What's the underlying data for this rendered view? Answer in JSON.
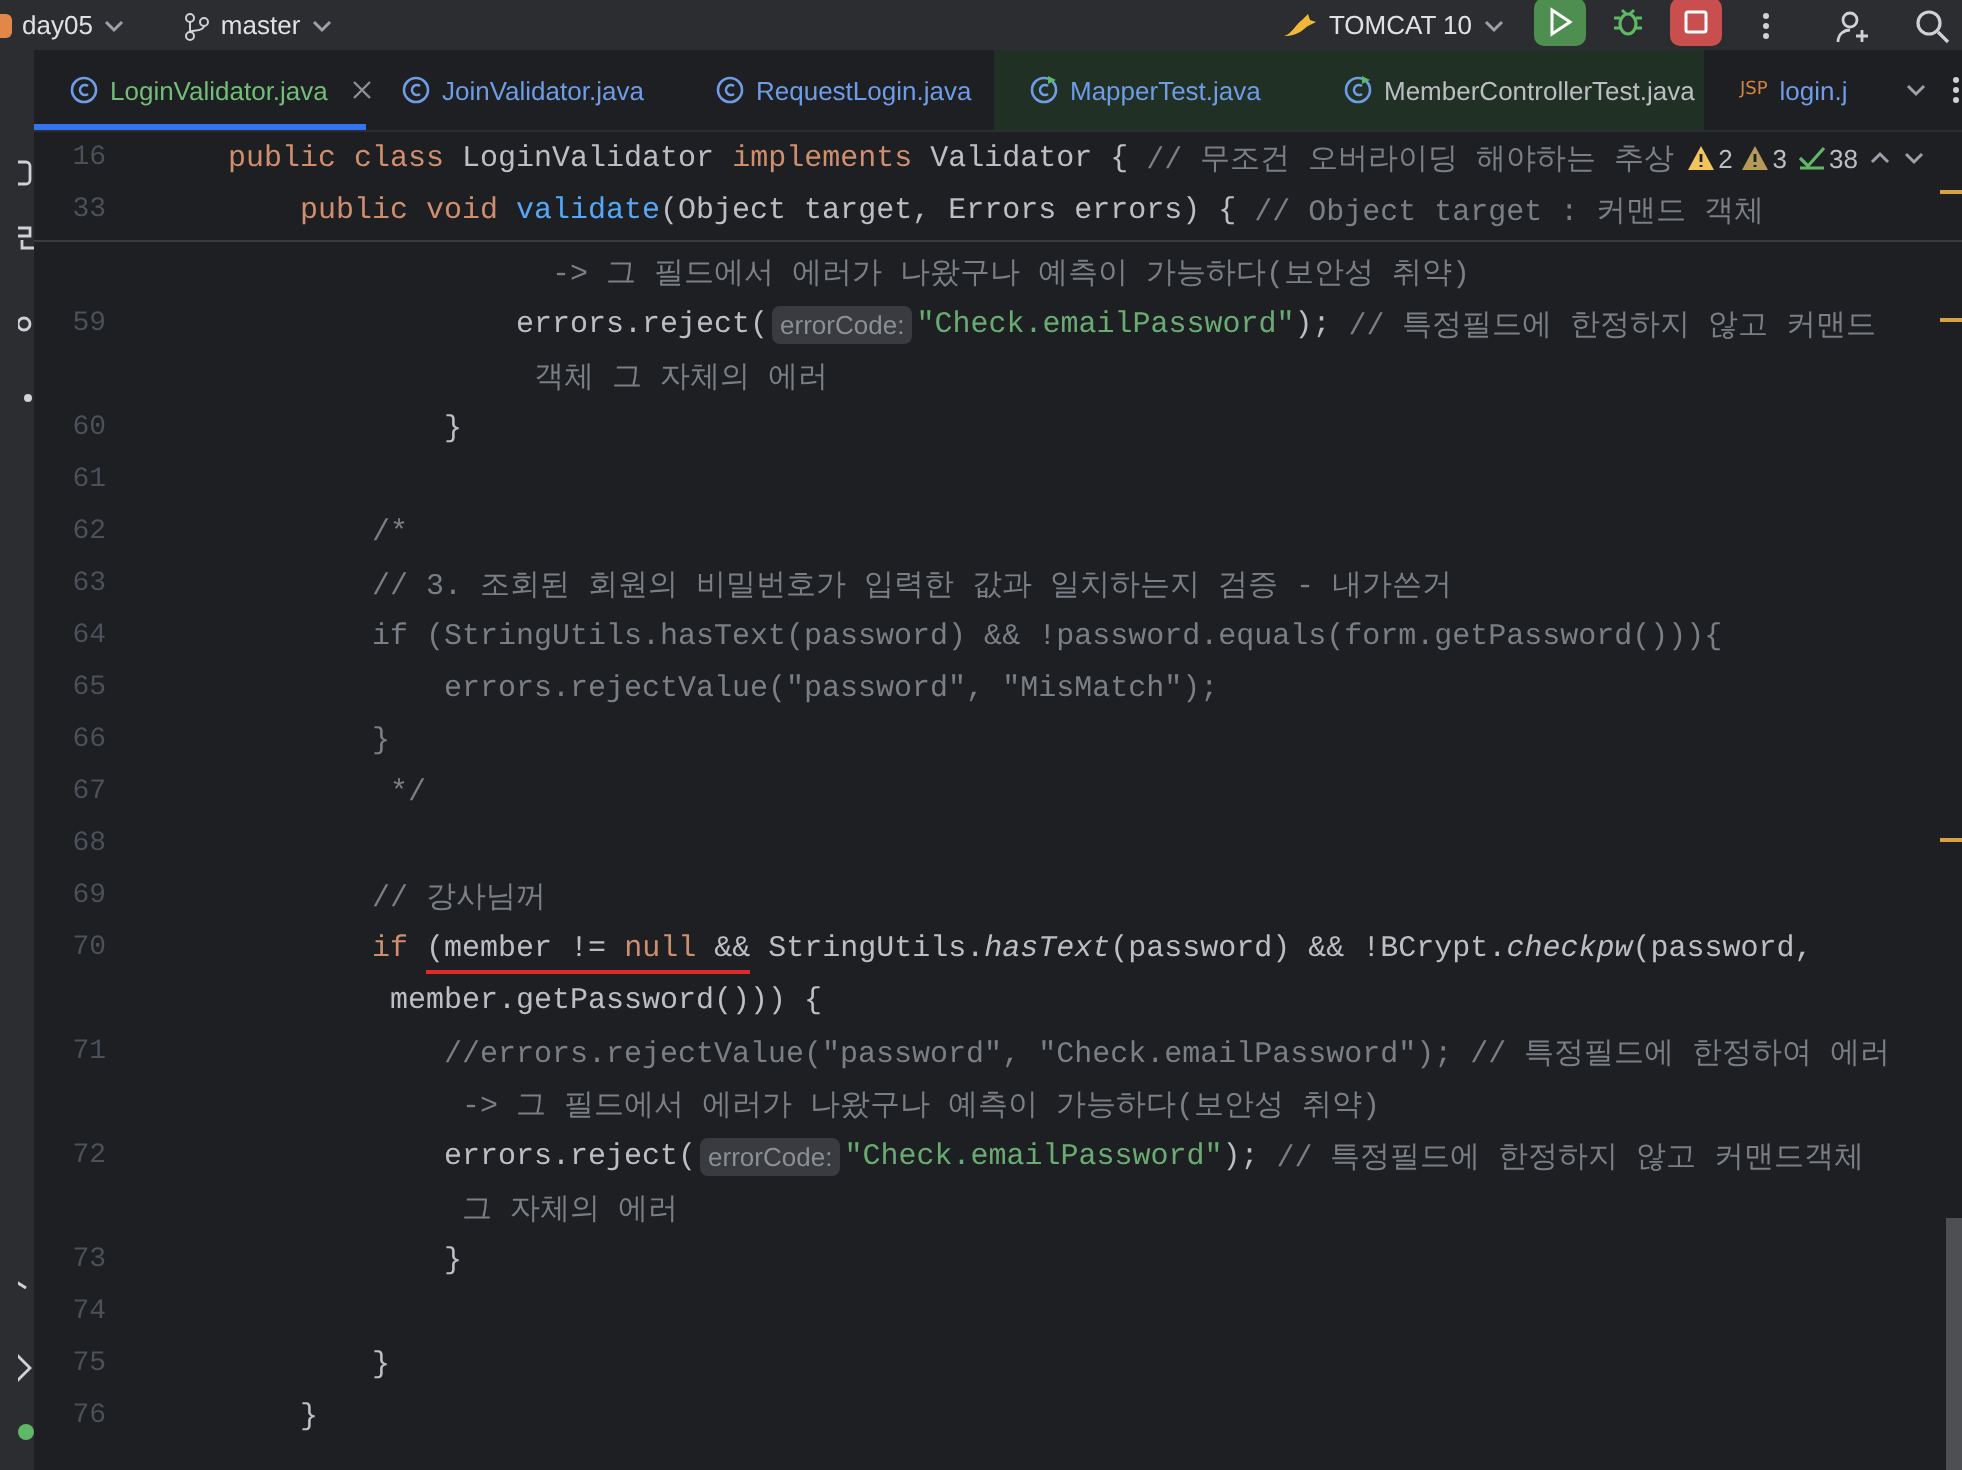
{
  "topbar": {
    "project": "day05",
    "branch": "master",
    "run_config": "TOMCAT 10"
  },
  "tabs": [
    {
      "label": "LoginValidator.java",
      "selected": true,
      "test": false,
      "color": "#73bd79",
      "closable": true
    },
    {
      "label": "JoinValidator.java",
      "selected": false,
      "test": false,
      "color": "#6f9ce6",
      "closable": false
    },
    {
      "label": "RequestLogin.java",
      "selected": false,
      "test": false,
      "color": "#6f9ce6",
      "closable": false
    },
    {
      "label": "MapperTest.java",
      "selected": false,
      "test": true,
      "color": "#6f9ce6",
      "closable": false
    },
    {
      "label": "MemberControllerTest.java",
      "selected": false,
      "test": true,
      "color": "#bcbec4",
      "closable": false
    },
    {
      "label": "login.j",
      "selected": false,
      "test": false,
      "color": "#6f9ce6",
      "closable": false,
      "badge": "JSP"
    }
  ],
  "inspections": [
    {
      "kind": "warning",
      "count": "2"
    },
    {
      "kind": "weak-warning",
      "count": "3"
    },
    {
      "kind": "ok",
      "count": "38"
    }
  ],
  "sticky_lines": [
    {
      "number": "16",
      "tokens": [
        {
          "kind": "keyword",
          "text": "public class "
        },
        {
          "kind": "plain",
          "text": "LoginValidator "
        },
        {
          "kind": "keyword",
          "text": "implements "
        },
        {
          "kind": "plain",
          "text": "Validator { "
        },
        {
          "kind": "comment",
          "text": "// 무조건 오버라이딩 해야하는 추상"
        }
      ]
    },
    {
      "number": "33",
      "tokens": [
        {
          "kind": "keyword",
          "text": "    public void "
        },
        {
          "kind": "method",
          "text": "validate"
        },
        {
          "kind": "plain",
          "text": "(Object target, Errors errors) { "
        },
        {
          "kind": "comment",
          "text": "// Object target : 커맨드 객체"
        }
      ]
    }
  ],
  "lines": [
    {
      "tokens": [
        {
          "kind": "comment",
          "text": "                  -> 그 필드에서 에러가 나왔구나 예측이 가능하다(보안성 취약)"
        }
      ]
    },
    {
      "number": "59",
      "tokens": [
        {
          "kind": "plain",
          "text": "                errors.reject("
        },
        {
          "kind": "hint",
          "text": "errorCode:"
        },
        {
          "kind": "string",
          "text": "\"Check.emailPassword\""
        },
        {
          "kind": "plain",
          "text": "); "
        },
        {
          "kind": "comment",
          "text": "// 특정필드에 한정하지 않고 커맨드"
        }
      ]
    },
    {
      "tokens": [
        {
          "kind": "comment",
          "text": "                 객체 그 자체의 에러"
        }
      ]
    },
    {
      "number": "60",
      "tokens": [
        {
          "kind": "plain",
          "text": "            }"
        }
      ]
    },
    {
      "number": "61"
    },
    {
      "number": "62",
      "tokens": [
        {
          "kind": "comment",
          "text": "        /*"
        }
      ]
    },
    {
      "number": "63",
      "tokens": [
        {
          "kind": "comment",
          "text": "        // 3. 조회된 회원의 비밀번호가 입력한 값과 일치하는지 검증 - 내가쓴거"
        }
      ]
    },
    {
      "number": "64",
      "tokens": [
        {
          "kind": "comment",
          "text": "        if (StringUtils.hasText(password) && !password.equals(form.getPassword())){"
        }
      ]
    },
    {
      "number": "65",
      "tokens": [
        {
          "kind": "comment",
          "text": "            errors.rejectValue(\"password\", \"MisMatch\");"
        }
      ]
    },
    {
      "number": "66",
      "tokens": [
        {
          "kind": "comment",
          "text": "        }"
        }
      ]
    },
    {
      "number": "67",
      "tokens": [
        {
          "kind": "comment",
          "text": "         */"
        }
      ]
    },
    {
      "number": "68"
    },
    {
      "number": "69",
      "tokens": [
        {
          "kind": "comment",
          "text": "        // 강사님꺼"
        }
      ]
    },
    {
      "number": "70",
      "tokens": [
        {
          "kind": "keyword",
          "text": "        if "
        },
        {
          "kind": "plain",
          "text": "(member != ",
          "underlined": true
        },
        {
          "kind": "keyword",
          "text": "null",
          "underlined": true
        },
        {
          "kind": "plain",
          "text": " &&",
          "underlined": true
        },
        {
          "kind": "plain",
          "text": " StringUtils."
        },
        {
          "kind": "static",
          "text": "hasText"
        },
        {
          "kind": "plain",
          "text": "(password) && !BCrypt."
        },
        {
          "kind": "static",
          "text": "checkpw"
        },
        {
          "kind": "plain",
          "text": "(password,"
        }
      ]
    },
    {
      "tokens": [
        {
          "kind": "plain",
          "text": "         member.getPassword())) {"
        }
      ]
    },
    {
      "number": "71",
      "tokens": [
        {
          "kind": "comment",
          "text": "            //errors.rejectValue(\"password\", \"Check.emailPassword\"); // 특정필드에 한정하여 에러"
        }
      ]
    },
    {
      "tokens": [
        {
          "kind": "comment",
          "text": "             -> 그 필드에서 에러가 나왔구나 예측이 가능하다(보안성 취약)"
        }
      ]
    },
    {
      "number": "72",
      "tokens": [
        {
          "kind": "plain",
          "text": "            errors.reject("
        },
        {
          "kind": "hint",
          "text": "errorCode:"
        },
        {
          "kind": "string",
          "text": "\"Check.emailPassword\""
        },
        {
          "kind": "plain",
          "text": "); "
        },
        {
          "kind": "comment",
          "text": "// 특정필드에 한정하지 않고 커맨드객체"
        }
      ]
    },
    {
      "tokens": [
        {
          "kind": "comment",
          "text": "             그 자체의 에러"
        }
      ]
    },
    {
      "number": "73",
      "tokens": [
        {
          "kind": "plain",
          "text": "            }"
        }
      ]
    },
    {
      "number": "74"
    },
    {
      "number": "75",
      "tokens": [
        {
          "kind": "plain",
          "text": "        }"
        }
      ]
    },
    {
      "number": "76",
      "tokens": [
        {
          "kind": "plain",
          "text": "    }"
        }
      ]
    }
  ]
}
